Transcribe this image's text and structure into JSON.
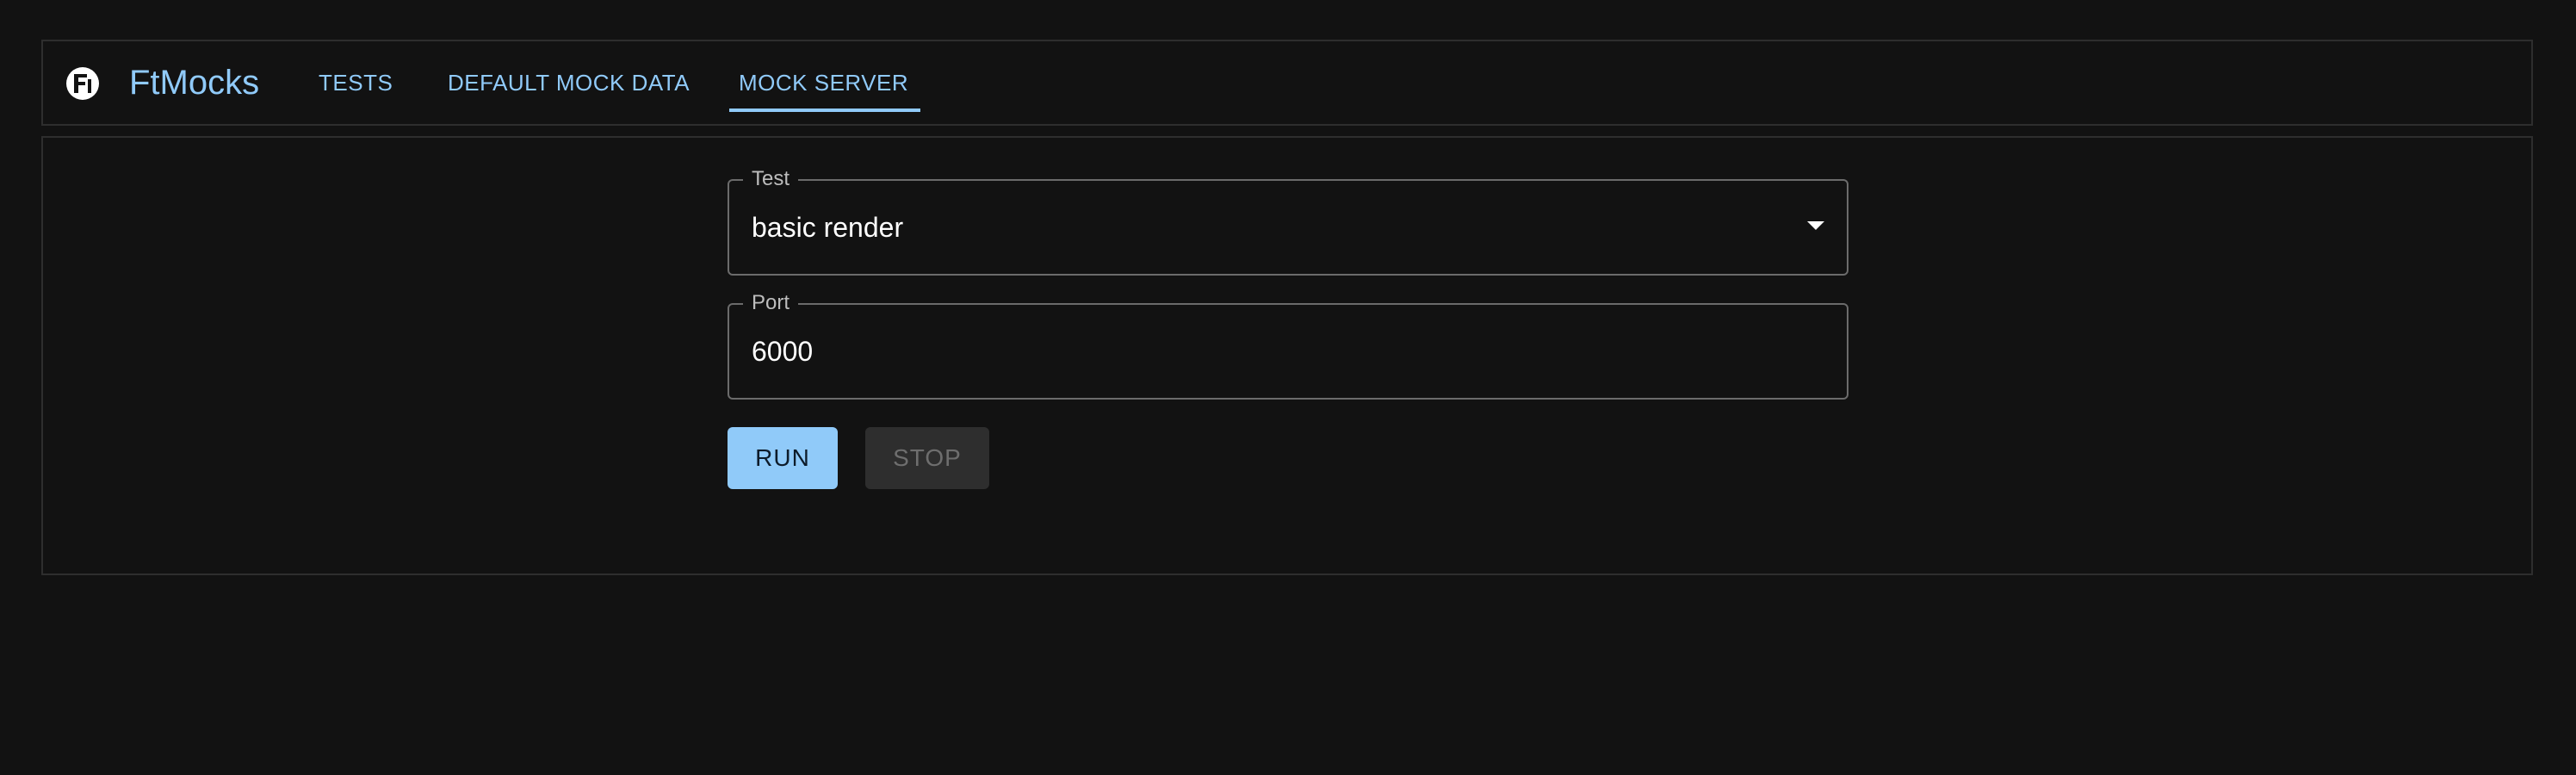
{
  "app": {
    "brand": "FtMocks"
  },
  "nav": {
    "tabs": [
      {
        "label": "TESTS"
      },
      {
        "label": "DEFAULT MOCK DATA"
      },
      {
        "label": "MOCK SERVER",
        "selected": true
      }
    ]
  },
  "form": {
    "test": {
      "label": "Test",
      "value": "basic render"
    },
    "port": {
      "label": "Port",
      "value": "6000"
    }
  },
  "actions": {
    "run_label": "RUN",
    "stop_label": "STOP",
    "stop_disabled": true
  },
  "colors": {
    "background": "#121212",
    "accent": "#90caf9",
    "border": "#2e2e2e"
  },
  "icons": {
    "logo": "ftmocks-logo-icon",
    "dropdown": "chevron-down-icon"
  }
}
